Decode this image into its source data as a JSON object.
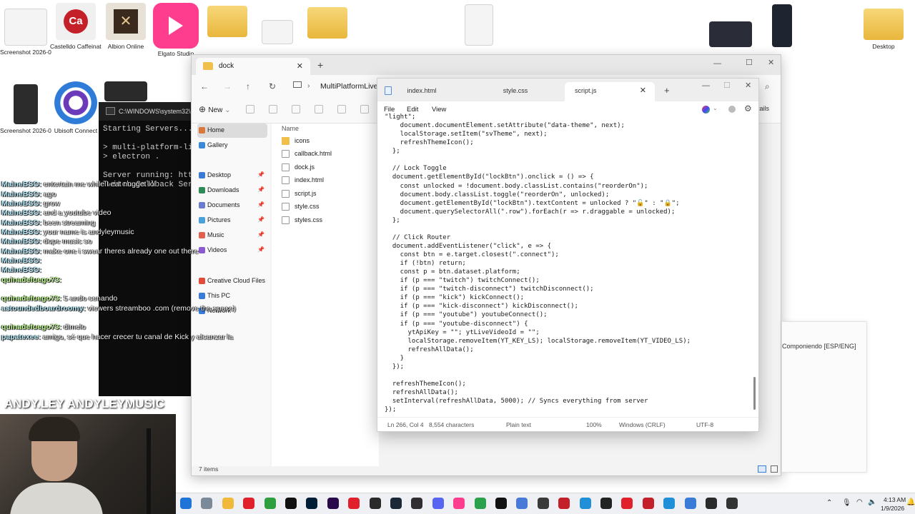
{
  "desktop": {
    "icons": [
      {
        "label": "Screenshot 2026-01 ...",
        "color": "#e9e9e9"
      },
      {
        "label": "Castelldo Caffeinated",
        "color": "#ececec"
      },
      {
        "label": "Albion Online",
        "color": "#d9d0c0"
      },
      {
        "label": "Elgato Studio",
        "color": "#ff3d8e"
      },
      {
        "label": "Desktop",
        "color": "#f2c75b"
      }
    ],
    "left_icons": [
      {
        "label": "Screenshot 2026-01 ...",
        "color": "#2c2c2c"
      },
      {
        "label": "Ubisoft Connect",
        "color": "#6b3ab8"
      }
    ]
  },
  "terminal": {
    "title": "C:\\WINDOWS\\system32\\cmd.exe",
    "lines": [
      "Starting Servers...",
      "",
      "> multi-platform-live",
      "> electron .",
      "",
      "Server running: http:",
      "Twitch Callback Serve"
    ]
  },
  "chat": {
    "messages": [
      {
        "user": "MaineBSO:",
        "text": "entertain me while I eat nugget lol"
      },
      {
        "user": "MaineBSO:",
        "text": "ago"
      },
      {
        "user": "MaineBSO:",
        "text": "grow"
      },
      {
        "user": "MaineBSO:",
        "text": "and a youtube video"
      },
      {
        "user": "MaineBSO:",
        "text": "been streaming"
      },
      {
        "user": "MaineBSO:",
        "text": "your name is andyleymusic"
      },
      {
        "user": "MaineBSO:",
        "text": "dope music so"
      },
      {
        "user": "MaineBSO:",
        "text": "make one i swear theres already one out there"
      },
      {
        "user": "MaineBSO:",
        "text": ""
      },
      {
        "user": "MaineBSO:",
        "text": ""
      },
      {
        "user": "quinadefuego73:",
        "text": ""
      },
      {
        "user": "quinadefuego73:",
        "text": "5 ando cenando"
      },
      {
        "user": "astoundedboardroomy:",
        "text": "viewers streamboo .com (remove the space)"
      },
      {
        "user": "quinadefuego73:",
        "text": "dimelo"
      },
      {
        "user": "papatexee:",
        "text": "amigo, sé que hacer crecer tu canal de Kick y alcanzar la"
      }
    ],
    "banner": "ANDY.LEY  ANDYLEYMUSIC"
  },
  "explorer": {
    "tab_title": "dock",
    "path": "MultiPlatformLiveC",
    "new_label": "New",
    "details_label": "tails",
    "nav": [
      {
        "label": "Home",
        "color": "#d8783a",
        "pinned": false
      },
      {
        "label": "Gallery",
        "color": "#3a8ad8",
        "pinned": false
      },
      {
        "label": "Desktop",
        "color": "#3a7bd8",
        "pinned": true
      },
      {
        "label": "Downloads",
        "color": "#2e8a57",
        "pinned": true
      },
      {
        "label": "Documents",
        "color": "#6b7bd0",
        "pinned": true
      },
      {
        "label": "Pictures",
        "color": "#4aa0d8",
        "pinned": true
      },
      {
        "label": "Music",
        "color": "#e0624e",
        "pinned": true
      },
      {
        "label": "Videos",
        "color": "#8a5bd0",
        "pinned": true
      },
      {
        "label": "Creative Cloud Files",
        "color": "#e24a3a",
        "pinned": false
      },
      {
        "label": "This PC",
        "color": "#3a7bd8",
        "pinned": false
      },
      {
        "label": "Network",
        "color": "#3a7bd8",
        "pinned": false
      }
    ],
    "column_header": "Name",
    "files": [
      {
        "name": "icons",
        "dir": true
      },
      {
        "name": "callback.html",
        "dir": false
      },
      {
        "name": "dock.js",
        "dir": false
      },
      {
        "name": "index.html",
        "dir": false
      },
      {
        "name": "script.js",
        "dir": false
      },
      {
        "name": "style.css",
        "dir": false
      },
      {
        "name": "styles.css",
        "dir": false
      }
    ],
    "status": "7 items"
  },
  "right_panel": {
    "title": "Componiendo [ESP/ENG]"
  },
  "notepad": {
    "tabs": [
      {
        "label": "index.html",
        "active": false
      },
      {
        "label": "style.css",
        "active": false
      },
      {
        "label": "script.js",
        "active": true
      }
    ],
    "menu": [
      "File",
      "Edit",
      "View"
    ],
    "code": "\"light\";\n    document.documentElement.setAttribute(\"data-theme\", next);\n    localStorage.setItem(\"svTheme\", next);\n    refreshThemeIcon();\n  };\n\n  // Lock Toggle\n  document.getElementById(\"lockBtn\").onclick = () => {\n    const unlocked = !document.body.classList.contains(\"reorderOn\");\n    document.body.classList.toggle(\"reorderOn\", unlocked);\n    document.getElementById(\"lockBtn\").textContent = unlocked ? \"🔓\" : \"🔒\";\n    document.querySelectorAll(\".row\").forEach(r => r.draggable = unlocked);\n  };\n\n  // Click Router\n  document.addEventListener(\"click\", e => {\n    const btn = e.target.closest(\".connect\");\n    if (!btn) return;\n    const p = btn.dataset.platform;\n    if (p === \"twitch\") twitchConnect();\n    if (p === \"twitch-disconnect\") twitchDisconnect();\n    if (p === \"kick\") kickConnect();\n    if (p === \"kick-disconnect\") kickDisconnect();\n    if (p === \"youtube\") youtubeConnect();\n    if (p === \"youtube-disconnect\") {\n      ytApiKey = \"\"; ytLiveVideoId = \"\";\n      localStorage.removeItem(YT_KEY_LS); localStorage.removeItem(YT_VIDEO_LS);\n      refreshAllData();\n    }\n  });\n\n  refreshThemeIcon();\n  refreshAllData();\n  setInterval(refreshAllData, 5000); // Syncs everything from server\n});",
    "status": {
      "position": "Ln 266, Col 4",
      "chars": "8,554 characters",
      "format": "Plain text",
      "zoom": "100%",
      "eol": "Windows (CRLF)",
      "encoding": "UTF-8"
    }
  },
  "taskbar": {
    "time": "4:13 AM",
    "date": "1/9/2026",
    "apps": [
      {
        "name": "start",
        "color": "#1f74d8"
      },
      {
        "name": "photos",
        "color": "#7a8a99"
      },
      {
        "name": "file-explorer",
        "color": "#f0b93a"
      },
      {
        "name": "opera",
        "color": "#e0202a"
      },
      {
        "name": "xbox",
        "color": "#2e9e3e"
      },
      {
        "name": "capcut",
        "color": "#111111"
      },
      {
        "name": "photoshop",
        "color": "#001e36"
      },
      {
        "name": "premiere",
        "color": "#2a0a4a"
      },
      {
        "name": "media",
        "color": "#e0202a"
      },
      {
        "name": "epic-games",
        "color": "#2a2a2a"
      },
      {
        "name": "steam",
        "color": "#1b2838"
      },
      {
        "name": "obs",
        "color": "#302e31"
      },
      {
        "name": "discord",
        "color": "#5865f2"
      },
      {
        "name": "elgato",
        "color": "#ff3d8e"
      },
      {
        "name": "chrome",
        "color": "#2aa14a"
      },
      {
        "name": "tiktok",
        "color": "#111111"
      },
      {
        "name": "app",
        "color": "#4a7ad8"
      },
      {
        "name": "app2",
        "color": "#3a3a3a"
      },
      {
        "name": "caffeinated",
        "color": "#c4202a"
      },
      {
        "name": "edge",
        "color": "#1f8fd8"
      },
      {
        "name": "app3",
        "color": "#222222"
      },
      {
        "name": "app4",
        "color": "#e0202a"
      },
      {
        "name": "castelldo",
        "color": "#c4202a"
      },
      {
        "name": "edge2",
        "color": "#1f8fd8"
      },
      {
        "name": "notepad",
        "color": "#3a7bd8"
      },
      {
        "name": "terminal",
        "color": "#2a2a2a"
      },
      {
        "name": "app5",
        "color": "#333333"
      }
    ]
  }
}
